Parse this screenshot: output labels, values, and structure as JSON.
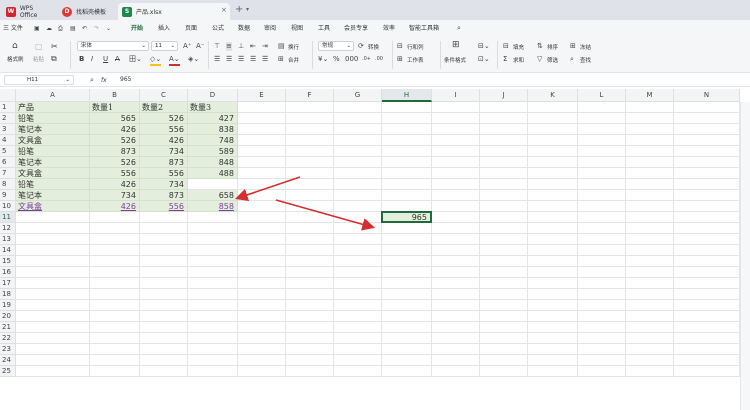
{
  "titlebar": {
    "tabs": [
      {
        "label": "WPS Office",
        "icon": "wps-logo-icon",
        "color": "#d7232e"
      },
      {
        "label": "找稻壳模板",
        "icon": "docer-icon",
        "color": "#e0382f"
      },
      {
        "label": "产品.xlsx",
        "icon": "sheet-icon",
        "color": "#1b8a4a"
      }
    ],
    "new_tab": "+"
  },
  "menu": {
    "file": "三 文件",
    "items": [
      "开始",
      "插入",
      "页面",
      "公式",
      "数据",
      "审阅",
      "视图",
      "工具",
      "会员专享",
      "效率",
      "智能工具箱"
    ],
    "active": "开始"
  },
  "ribbon": {
    "format_painter": "格式刷",
    "paste": "粘贴",
    "font_name": "宋体",
    "font_size": "11",
    "wrap": "换行",
    "merge": "合并",
    "number_format": "常规",
    "convert": "转换",
    "row_col": "行和列",
    "worksheet": "工作表",
    "cond_format": "条件格式",
    "fill": "填充",
    "sort": "排序",
    "freeze": "冻结",
    "sum": "求和",
    "filter": "筛选",
    "find": "查找"
  },
  "formula_bar": {
    "name_box": "H11",
    "fx": "fx",
    "value": "965"
  },
  "columns": [
    "A",
    "B",
    "C",
    "D",
    "E",
    "F",
    "G",
    "H",
    "I",
    "J",
    "K",
    "L",
    "M",
    "N"
  ],
  "selected_column": "H",
  "rows": [
    "1",
    "2",
    "3",
    "4",
    "5",
    "6",
    "7",
    "8",
    "9",
    "10",
    "11",
    "12",
    "13",
    "14",
    "15",
    "16",
    "17",
    "18",
    "19",
    "20",
    "21",
    "22",
    "23",
    "24",
    "25"
  ],
  "sheet": {
    "headers": [
      "产品",
      "数量1",
      "数量2",
      "数量3"
    ],
    "data": [
      [
        "铅笔",
        "565",
        "526",
        "427"
      ],
      [
        "笔记本",
        "426",
        "556",
        "838"
      ],
      [
        "文具盒",
        "526",
        "426",
        "748"
      ],
      [
        "铅笔",
        "873",
        "734",
        "589"
      ],
      [
        "笔记本",
        "526",
        "873",
        "848"
      ],
      [
        "文具盒",
        "556",
        "556",
        "488"
      ],
      [
        "铅笔",
        "426",
        "734",
        ""
      ],
      [
        "笔记本",
        "734",
        "873",
        "658"
      ],
      [
        "文具盒",
        "426",
        "556",
        "858"
      ]
    ],
    "active_cell_value": "965"
  },
  "colors": {
    "accent": "#1f6b3b",
    "highlight": "#e3efdc",
    "arrow": "#d32f2f"
  }
}
